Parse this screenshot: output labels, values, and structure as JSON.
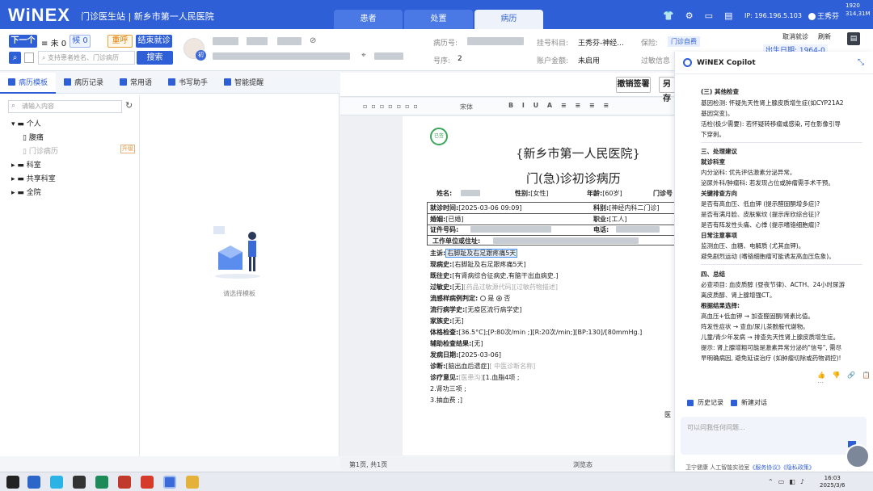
{
  "header": {
    "logo": "WiNEX",
    "menu": "门诊医生站 | 新乡市第一人民医院",
    "tabs": [
      {
        "label": "患者"
      },
      {
        "label": "处置"
      },
      {
        "label": "病历"
      }
    ],
    "ip": "IP: 196.196.5.103",
    "user": "王秀芬",
    "corner_top": "1920",
    "corner_bottom": "314,31M"
  },
  "patientbar": {
    "next_label": "下一个",
    "not_seen": "未 0",
    "waiting": "候 0",
    "recall_label": "重呼",
    "end_label": "结束就诊",
    "search_placeholder": "支持患者姓名、门诊病历",
    "search_label": "搜索",
    "avatar_tag": "初",
    "record_no_label": "病历号:",
    "seq_label": "号序:",
    "seq_value": "2",
    "dept_label": "挂号科目:",
    "dept_value": "王秀芬-神经...",
    "account_label": "账户金额:",
    "account_value": "未启用",
    "insurance_label": "保险:",
    "insurance_value": "门诊自费",
    "allergy_label": "过敏信息",
    "cancel_label": "取消就诊",
    "refresh_label": "刷新",
    "birth_label": "出生日期: 1964-0"
  },
  "left": {
    "tabs": [
      {
        "label": "病历模板"
      },
      {
        "label": "病历记录"
      },
      {
        "label": "常用语"
      },
      {
        "label": "书写助手"
      },
      {
        "label": "智能提醒"
      }
    ],
    "search_placeholder": "请输入内容",
    "tree": [
      {
        "label": "个人",
        "level": 0
      },
      {
        "label": "腹痛",
        "level": 1
      },
      {
        "label": "门诊病历",
        "level": 1
      },
      {
        "label": "科室",
        "level": 0
      },
      {
        "label": "共享科室",
        "level": 0
      },
      {
        "label": "全院",
        "level": 0
      }
    ],
    "upgrade_label": "升级",
    "empty_text": "请选择模板"
  },
  "doc": {
    "revoke_label": "撤销签署",
    "other_label": "另存",
    "font_name": "宋体",
    "hospital": "{新乡市第一人民医院}",
    "title": "门(急)诊初诊病历",
    "name_label": "姓名:",
    "gender_label": "性别:",
    "gender_value": "[女性]",
    "age_label": "年龄:",
    "age_value": "[60岁]",
    "clinic_label": "门诊号",
    "visit_time_label": "就诊时间:",
    "visit_time_value": "[2025-03-06 09:09]",
    "dept_label": "科别:",
    "dept_value": "[神经内科二门诊]",
    "marriage_label": "婚姻:",
    "marriage_value": "[已婚]",
    "job_label": "职业:",
    "job_value": "[工人]",
    "id_label": "证件号码:",
    "phone_label": "电话:",
    "work_label": "工作单位或住址:",
    "complaint_label": "主诉:",
    "complaint_value": "右脚趾及右足跟疼痛5天",
    "present_label": "现病史:",
    "present_value": "[右脚趾及右足跟疼痛5天]",
    "past_label": "既往史:",
    "past_value": "[有肾病综合征病史,有脑干出血病史.]",
    "allergy_label": "过敏史:",
    "allergy_value": "[无]",
    "allergy_hint": "[药品过敏源代码][过敏药物描述]",
    "flu_label": "流感样病例判定:",
    "flu_yes": "是",
    "flu_no": "否",
    "epi_label": "流行病学史:",
    "epi_value": "[无疫区流行病学史]",
    "family_label": "家族史:",
    "family_value": "[无]",
    "exam_label": "体格检查:",
    "exam_value": "[36.5°C];[P:80次/min ;][R:20次/min;][BP:130]/[80mmHg.]",
    "aux_label": "辅助检查结果:",
    "aux_value": "[无]",
    "onset_label": "发病日期:",
    "onset_value": "[2025-03-06]",
    "diag_label": "诊断:",
    "diag_value": "[脑出血后遗症]",
    "diag_hint": "[ 中医诊断名称]",
    "advice_label": "诊疗意见:",
    "advice_hint": "[医患沟]",
    "advice_value": "[1.血脂4项 ;",
    "advice_2": "2.肾功三项 ;",
    "advice_3": "3.抽血费 ;]",
    "doctor_label": "医",
    "page_info": "第1页, 共1页",
    "view_mode": "浏览态"
  },
  "copilot": {
    "title": "WiNEX Copilot",
    "lines": [
      "(三) 其他检查",
      "基因检测: 怀疑先天性肾上腺皮质增生症(如CYP21A2",
      "基因突变)。",
      "活检(极少需要): 若怀疑转移瘤或感染, 可在影像引导",
      "下穿刺。",
      "三、处理建议",
      "就诊科室",
      "内分泌科: 优先评估激素分泌异常。",
      "泌尿外科/肿瘤科: 若发现占位或肿瘤需手术干预。",
      "关键排查方向",
      "是否有高血压、低血钾 (提示醛固酮增多症)?",
      "是否有满月脸、皮肤紫纹 (提示库欣综合征)?",
      "是否有阵发性头痛、心悸 (提示嗜铬细胞瘤)?",
      "日常注意事项",
      "监测血压、血糖、电解质 (尤其血钾)。",
      "避免剧烈运动 (嗜铬细胞瘤可能诱发高血压危象)。",
      "四、总结",
      "必查项目: 血皮质醇 (昼夜节律)、ACTH、24小时尿游",
      "离皮质醇、肾上腺增强CT。",
      "根据结果选择:",
      "高血压+低血钾 → 加查醛固酮/肾素比值。",
      "阵发性症状 → 查血/尿儿茶酚胺代谢物。",
      "儿童/青少年发病 → 排查先天性肾上腺皮质增生症。",
      "提示: 肾上腺增粗可能是激素异常分泌的\"信号\", 需尽",
      "早明确病因, 避免延误治疗 (如肿瘤切除或药物调控)!"
    ],
    "feedback": "👍 👎 🔗 📋 ⋯",
    "history_label": "历史记录",
    "new_chat_label": "新建对话",
    "input_placeholder": "可以问我任何问题...",
    "footer": "卫宁健康 人工智能实验室",
    "footer_link1": "《服务协议》",
    "footer_link2": "《隐私政策》"
  },
  "taskbar": {
    "time": "16:03",
    "date": "2025/3/6"
  }
}
